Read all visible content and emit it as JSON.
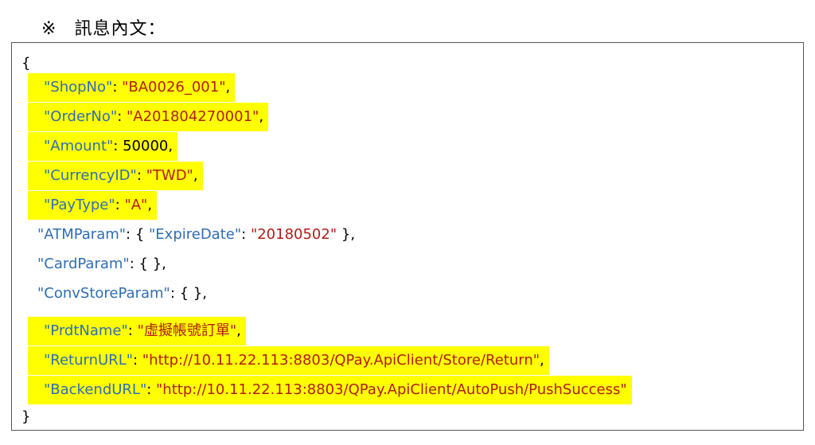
{
  "heading": {
    "mark": "※",
    "title": "訊息內文："
  },
  "code": {
    "open_brace": "{",
    "close_brace": "}",
    "lines": [
      {
        "key": "\"ShopNo\"",
        "value": "\"BA0026_001\"",
        "value_type": "string",
        "suffix": ",",
        "highlight": true
      },
      {
        "key": "\"OrderNo\"",
        "value": "\"A201804270001\"",
        "value_type": "string",
        "suffix": ",",
        "highlight": true
      },
      {
        "key": "\"Amount\"",
        "value": "50000",
        "value_type": "number",
        "suffix": ",",
        "highlight": true
      },
      {
        "key": "\"CurrencyID\"",
        "value": "\"TWD\"",
        "value_type": "string",
        "suffix": ",",
        "highlight": true
      },
      {
        "key": "\"PayType\"",
        "value": "\"A\"",
        "value_type": "string",
        "suffix": ",",
        "highlight": true
      },
      {
        "key": "\"ATMParam\"",
        "inner_key": "\"ExpireDate\"",
        "inner_value": "\"20180502\"",
        "value_type": "object",
        "suffix": ",",
        "highlight": false
      },
      {
        "key": "\"CardParam\"",
        "value": "{ }",
        "value_type": "empty",
        "suffix": ",",
        "highlight": false
      },
      {
        "key": "\"ConvStoreParam\"",
        "value": "{ }",
        "value_type": "empty",
        "suffix": ",",
        "highlight": false
      },
      {
        "key": "\"PrdtName\"",
        "value": "\"虛擬帳號訂單\"",
        "value_type": "string",
        "suffix": ",",
        "highlight": true
      },
      {
        "key": "\"ReturnURL\"",
        "value": "\"http://10.11.22.113:8803/QPay.ApiClient/Store/Return\"",
        "value_type": "string",
        "suffix": ",",
        "highlight": true
      },
      {
        "key": "\"BackendURL\"",
        "value": "\"http://10.11.22.113:8803/QPay.ApiClient/AutoPush/PushSuccess\"",
        "value_type": "string",
        "suffix": "",
        "highlight": true
      }
    ]
  },
  "colors": {
    "key": "#2f6db5",
    "string": "#b01d17",
    "highlight": "#ffff00",
    "border": "#555555"
  }
}
